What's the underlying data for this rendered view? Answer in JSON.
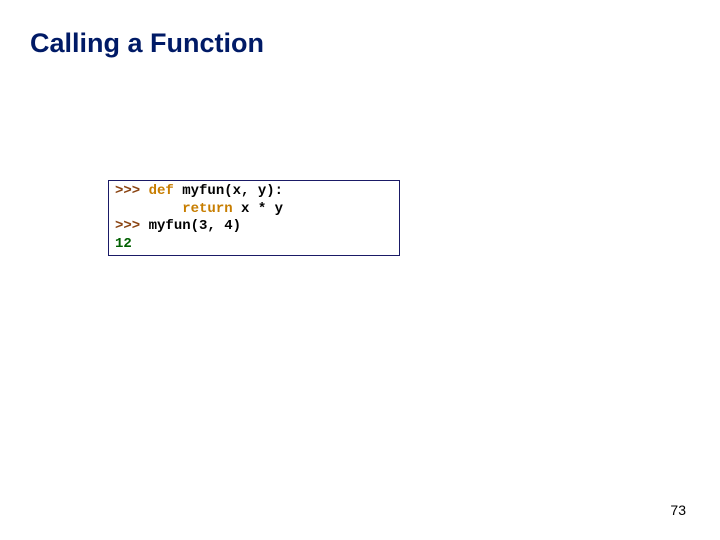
{
  "title": "Calling a Function",
  "code": {
    "p1": ">>> ",
    "kw_def": "def",
    "l1_rest": " myfun(x, y):",
    "indent": "        ",
    "kw_return": "return",
    "l2_rest": " x * y",
    "p2": ">>> ",
    "l3_rest": "myfun(3, 4)",
    "result": "12"
  },
  "page_number": "73"
}
